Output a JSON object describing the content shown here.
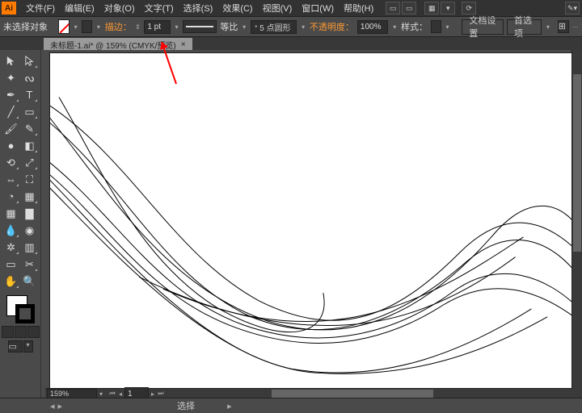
{
  "menubar": {
    "items": [
      "文件(F)",
      "编辑(E)",
      "对象(O)",
      "文字(T)",
      "选择(S)",
      "效果(C)",
      "视图(V)",
      "窗口(W)",
      "帮助(H)"
    ]
  },
  "controlbar": {
    "status": "未选择对象",
    "stroke_label": "描边：",
    "stroke_value": "1 pt",
    "proportional": "等比",
    "brush_value": "5 点圆形",
    "opacity_label": "不透明度：",
    "opacity_value": "100%",
    "style_label": "样式：",
    "doc_settings": "文档设置",
    "prefs": "首选项"
  },
  "tab": {
    "title": "未标题-1.ai* @ 159% (CMYK/预览)",
    "close": "×"
  },
  "zoom": "159%",
  "statusbar": {
    "mode": "选择"
  },
  "icons": {
    "dropdown": "▾",
    "left": "◂",
    "right": "▸",
    "up": "▴",
    "down": "▾"
  }
}
